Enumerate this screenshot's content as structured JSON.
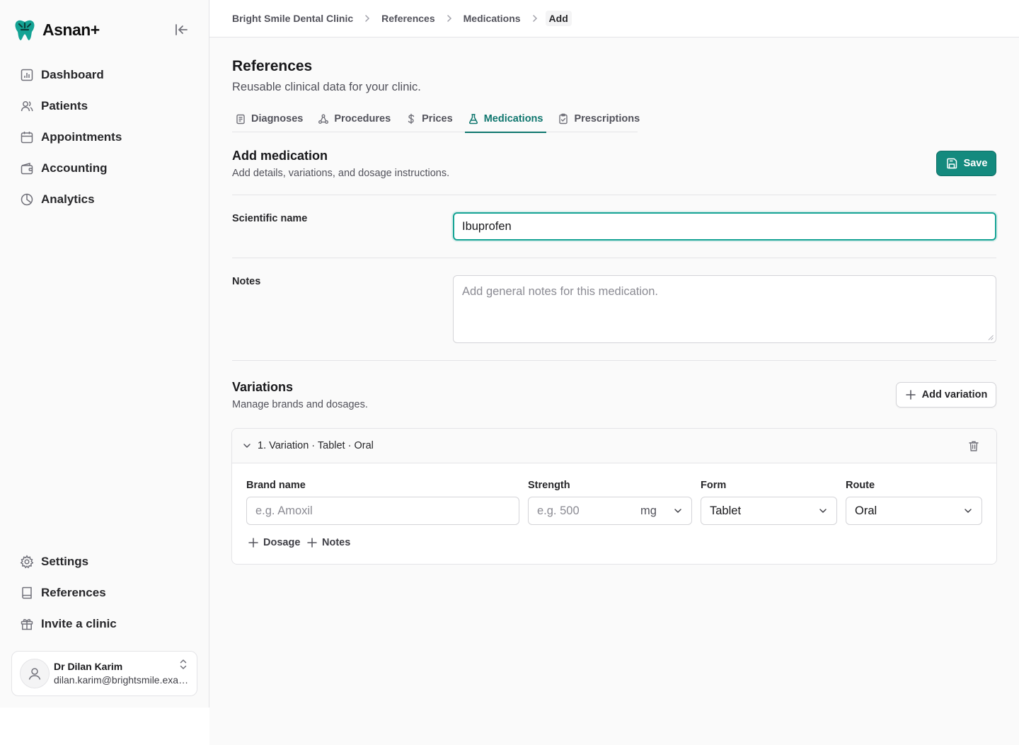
{
  "app": {
    "name": "Asnan+"
  },
  "sidebar": {
    "nav_top": [
      {
        "label": "Dashboard",
        "icon": "dashboard-icon"
      },
      {
        "label": "Patients",
        "icon": "users-icon"
      },
      {
        "label": "Appointments",
        "icon": "calendar-icon"
      },
      {
        "label": "Accounting",
        "icon": "wallet-icon"
      },
      {
        "label": "Analytics",
        "icon": "pie-chart-icon"
      }
    ],
    "nav_bottom": [
      {
        "label": "Settings",
        "icon": "gear-icon"
      },
      {
        "label": "References",
        "icon": "book-icon"
      },
      {
        "label": "Invite a clinic",
        "icon": "gift-icon"
      }
    ],
    "user": {
      "name": "Dr Dilan Karim",
      "email": "dilan.karim@brightsmile.example"
    }
  },
  "breadcrumb": [
    "Bright Smile Dental Clinic",
    "References",
    "Medications",
    "Add"
  ],
  "page": {
    "title": "References",
    "subtitle": "Reusable clinical data for your clinic."
  },
  "tabs": [
    {
      "label": "Diagnoses",
      "icon": "clipboard-list-icon",
      "active": false
    },
    {
      "label": "Procedures",
      "icon": "procedures-icon",
      "active": false
    },
    {
      "label": "Prices",
      "icon": "dollar-icon",
      "active": false
    },
    {
      "label": "Medications",
      "icon": "flask-icon",
      "active": true
    },
    {
      "label": "Prescriptions",
      "icon": "clipboard-check-icon",
      "active": false
    }
  ],
  "form": {
    "title": "Add medication",
    "subtitle": "Add details, variations, and dosage instructions.",
    "save_label": "Save",
    "scientific_name": {
      "label": "Scientific name",
      "value": "Ibuprofen"
    },
    "notes": {
      "label": "Notes",
      "placeholder": "Add general notes for this medication."
    }
  },
  "variations": {
    "title": "Variations",
    "subtitle": "Manage brands and dosages.",
    "add_label": "Add variation",
    "items": [
      {
        "title": "1. Variation · Tablet · Oral",
        "brand": {
          "label": "Brand name",
          "placeholder": "e.g. Amoxil"
        },
        "strength": {
          "label": "Strength",
          "placeholder": "e.g. 500",
          "unit": "mg"
        },
        "form": {
          "label": "Form",
          "value": "Tablet"
        },
        "route": {
          "label": "Route",
          "value": "Oral"
        },
        "add_dosage_label": "Dosage",
        "add_notes_label": "Notes"
      }
    ]
  },
  "colors": {
    "accent": "#148a7e",
    "accent_text": "#0f766e",
    "focus_ring": "#14a394"
  }
}
